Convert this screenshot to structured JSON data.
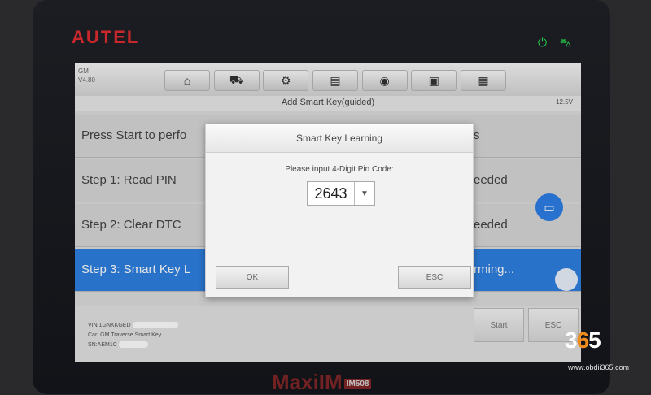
{
  "device": {
    "brand": "AUTEL",
    "model": "MaxiIM",
    "model_badge": "IM508"
  },
  "status_icons": {
    "power": "power-icon",
    "vehicle": "car-icon",
    "power_color": "#28d04a"
  },
  "topbar": {
    "vehicle_tag_line1": "GM",
    "vehicle_tag_line2": "V4.80",
    "toolbar": [
      {
        "name": "home-icon",
        "glyph": "⌂"
      },
      {
        "name": "vehicle-swap-icon",
        "glyph": "⛟"
      },
      {
        "name": "settings-icon",
        "glyph": "⚙"
      },
      {
        "name": "print-icon",
        "glyph": "▤"
      },
      {
        "name": "help-icon",
        "glyph": "◉"
      },
      {
        "name": "save-icon",
        "glyph": "▣"
      },
      {
        "name": "data-logging-icon",
        "glyph": "▦"
      }
    ]
  },
  "title": "Add Smart Key(guided)",
  "battery": "12.5V",
  "steps": [
    {
      "label": "Press Start to perfo",
      "status": "s"
    },
    {
      "label": "Step 1: Read PIN",
      "status": "eeded"
    },
    {
      "label": "Step 2: Clear DTC",
      "status": "eeded"
    },
    {
      "label": "Step 3: Smart Key L",
      "status": "rming..."
    }
  ],
  "footer": {
    "vin_label": "VIN:1GNKKGED",
    "car_label": "Car: GM Traverse Smart Key",
    "sn_label": "SN:AEM1C",
    "start_label": "Start",
    "esc_label": "ESC"
  },
  "dialog": {
    "title": "Smart Key Learning",
    "prompt": "Please input 4-Digit Pin Code:",
    "pin_value": "2643",
    "ok_label": "OK",
    "esc_label": "ESC"
  },
  "watermark": {
    "logo_3": "3",
    "logo_6": "6",
    "logo_5": "5",
    "url": "www.obdii365.com",
    "accent": "#f08a1d"
  },
  "colors": {
    "accent_blue": "#2e7fe0",
    "brand_red": "#c8272b"
  }
}
